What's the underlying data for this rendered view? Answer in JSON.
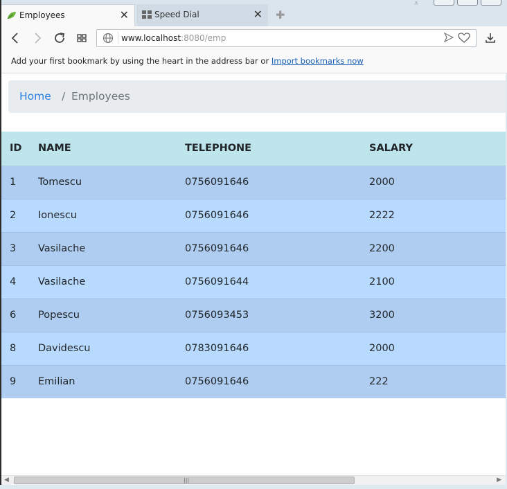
{
  "browser": {
    "tabs": [
      {
        "title": "Employees",
        "active": true
      },
      {
        "title": "Speed Dial",
        "active": false
      }
    ],
    "url": {
      "host": "www.localhost",
      "rest": ":8080/emp"
    },
    "bookmark_bar": {
      "message": "Add your first bookmark by using the heart in the address bar or ",
      "link": "Import bookmarks now"
    }
  },
  "breadcrumb": {
    "home": "Home",
    "separator": "/",
    "current": "Employees"
  },
  "table": {
    "headers": [
      "ID",
      "NAME",
      "TELEPHONE",
      "SALARY"
    ],
    "rows": [
      {
        "id": "1",
        "name": "Tomescu",
        "telephone": "0756091646",
        "salary": "2000"
      },
      {
        "id": "2",
        "name": "Ionescu",
        "telephone": "0756091646",
        "salary": "2222"
      },
      {
        "id": "3",
        "name": "Vasilache",
        "telephone": "0756091646",
        "salary": "2200"
      },
      {
        "id": "4",
        "name": "Vasilache",
        "telephone": "0756091644",
        "salary": "2100"
      },
      {
        "id": "6",
        "name": "Popescu",
        "telephone": "0756093453",
        "salary": "3200"
      },
      {
        "id": "8",
        "name": "Davidescu",
        "telephone": "0783091646",
        "salary": "2000"
      },
      {
        "id": "9",
        "name": "Emilian",
        "telephone": "0756091646",
        "salary": "222"
      }
    ]
  },
  "colors": {
    "header_bg": "#bee5eb",
    "row_odd": "#aecdf0",
    "row_even": "#b8daff",
    "link": "#2d7fe0"
  },
  "icons": [
    "leaf-favicon",
    "speed-dial-icon",
    "close-icon",
    "new-tab-icon",
    "back-icon",
    "forward-icon",
    "reload-icon",
    "tiles-icon",
    "globe-icon",
    "send-icon",
    "heart-icon",
    "download-icon"
  ]
}
